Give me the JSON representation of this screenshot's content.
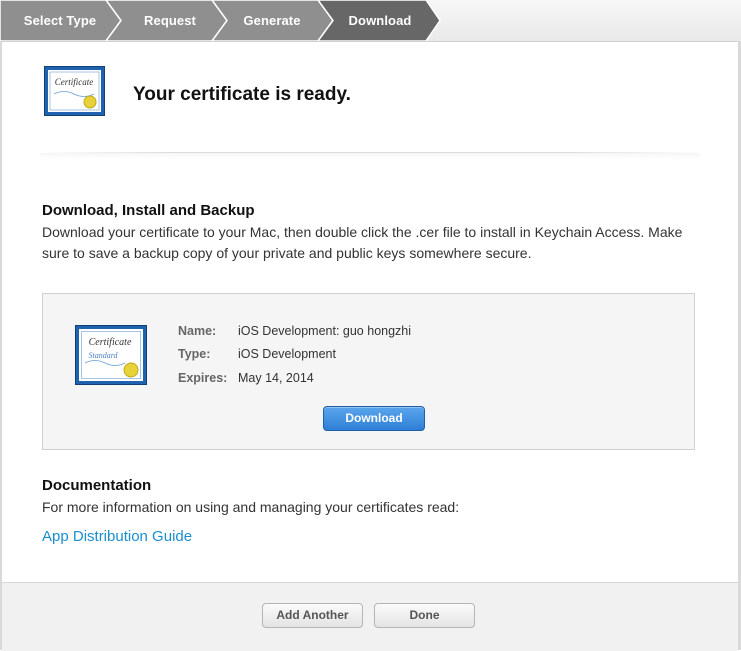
{
  "steps": [
    {
      "label": "Select Type"
    },
    {
      "label": "Request"
    },
    {
      "label": "Generate"
    },
    {
      "label": "Download",
      "active": true
    }
  ],
  "header": {
    "title": "Your certificate is ready.",
    "icon": "certificate-icon"
  },
  "download_section": {
    "title": "Download, Install and Backup",
    "description": "Download your certificate to your Mac, then double click the .cer file to install in Keychain Access. Make sure to save a backup copy of your private and public keys somewhere secure."
  },
  "certificate": {
    "icon_text": "Certificate",
    "icon_subtext": "Standard",
    "name_label": "Name:",
    "name_value": "iOS Development: guo hongzhi",
    "type_label": "Type:",
    "type_value": "iOS Development",
    "expires_label": "Expires:",
    "expires_value": "May 14, 2014",
    "download_label": "Download"
  },
  "documentation": {
    "title": "Documentation",
    "description": "For more information on using and managing your certificates read:",
    "link_label": "App Distribution Guide"
  },
  "footer": {
    "add_another_label": "Add Another",
    "done_label": "Done"
  },
  "colors": {
    "step_inactive": "#8f8f8f",
    "step_active": "#676767",
    "link": "#1a8fcf",
    "primary_button": "#2f7fd6"
  }
}
